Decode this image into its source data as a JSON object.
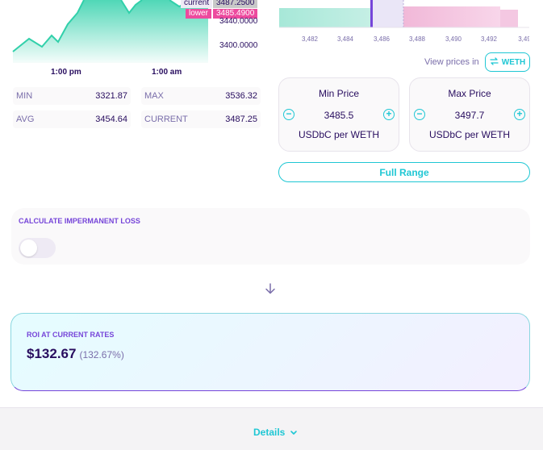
{
  "chart": {
    "time_labels": [
      "1:00 pm",
      "1:00 am"
    ],
    "current_label": "current",
    "current_value": "3487.2500",
    "lower_label": "lower",
    "lower_value": "3485.4900",
    "y_ticks": [
      "3440.0000",
      "3400.0000"
    ],
    "accent_color": "#31d0aa"
  },
  "stats": {
    "min_label": "MIN",
    "min_value": "3321.87",
    "max_label": "MAX",
    "max_value": "3536.32",
    "avg_label": "AVG",
    "avg_value": "3454.64",
    "current_label": "CURRENT",
    "current_value": "3487.25"
  },
  "liquidity": {
    "x_ticks": [
      "3,482",
      "3,484",
      "3,486",
      "3,488",
      "3,490",
      "3,492",
      "3,49"
    ]
  },
  "view_prices": {
    "label": "View prices in",
    "token": "WETH",
    "icon": "swap-arrows-icon"
  },
  "min_price": {
    "title": "Min Price",
    "value": "3485.5",
    "unit": "USDbC per WETH"
  },
  "max_price": {
    "title": "Max Price",
    "value": "3497.7",
    "unit": "USDbC per WETH"
  },
  "full_range_label": "Full Range",
  "impermanent_loss": {
    "title": "CALCULATE IMPERMANENT LOSS",
    "enabled": false
  },
  "roi": {
    "title": "ROI AT CURRENT RATES",
    "value": "$132.67",
    "percent": "(132.67%)"
  },
  "details_label": "Details",
  "colors": {
    "primary": "#1fc7d4",
    "secondary": "#7645d9",
    "text": "#280d5f",
    "text_subtle": "#7a6eaa",
    "failure": "#ed4b9e"
  }
}
